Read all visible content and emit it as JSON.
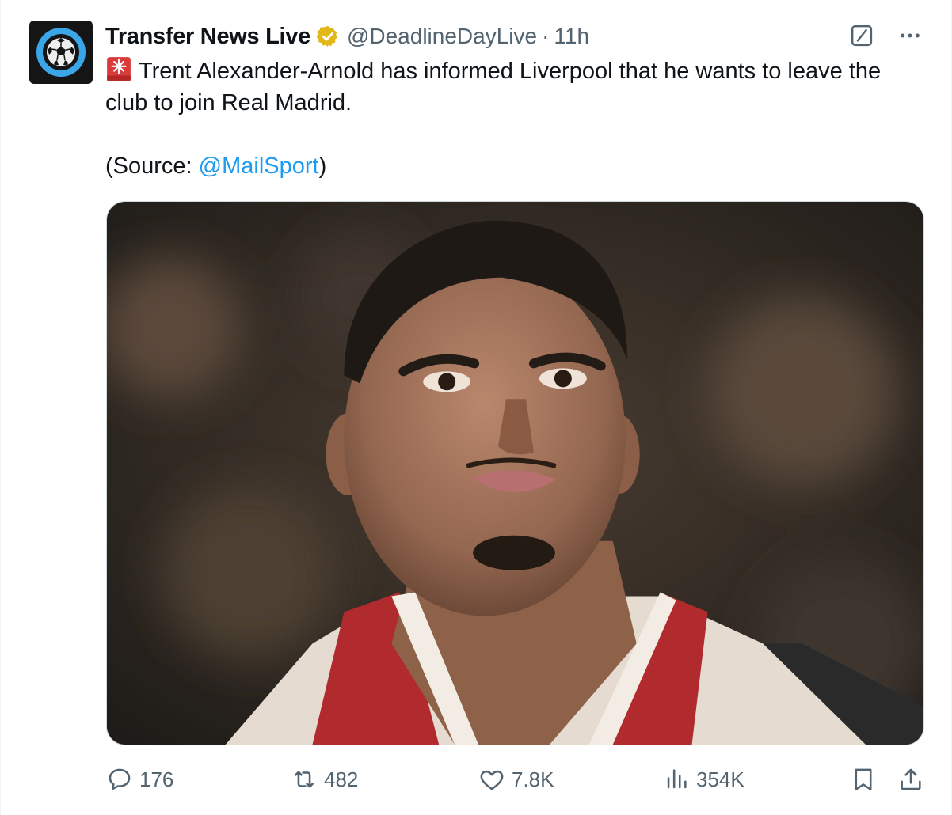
{
  "author": {
    "display_name": "Transfer News Live",
    "handle": "@DeadlineDayLive",
    "separator": "·",
    "timestamp": "11h",
    "verified": true,
    "verified_color": "#e2b719"
  },
  "tweet": {
    "line1": "Trent Alexander-Arnold has informed Liverpool that he wants to leave the club to join Real Madrid.",
    "source_prefix": "(Source: ",
    "source_mention": "@MailSport",
    "source_suffix": ")",
    "lead_emoji": "siren-icon"
  },
  "actions": {
    "replies": "176",
    "retweets": "482",
    "likes": "7.8K",
    "views": "354K"
  },
  "colors": {
    "text": "#0f1419",
    "secondary": "#536471",
    "link": "#1d9bf0",
    "avatar_ball_ring": "#3aa6e8"
  },
  "icons": [
    "grok-icon",
    "more-icon",
    "reply-icon",
    "retweet-icon",
    "like-icon",
    "views-icon",
    "bookmark-icon",
    "share-icon"
  ]
}
